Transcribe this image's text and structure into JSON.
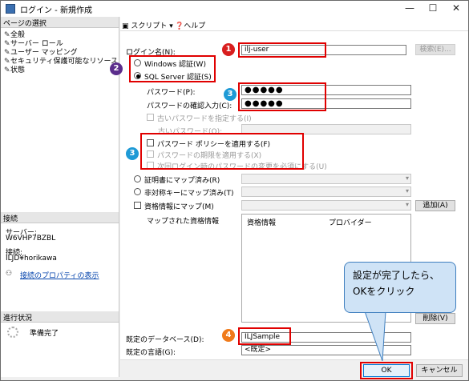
{
  "window": {
    "title": "ログイン - 新規作成"
  },
  "sidebar": {
    "pages_header": "ページの選択",
    "pages": [
      "全般",
      "サーバー ロール",
      "ユーザー マッピング",
      "セキュリティ保護可能なリソース",
      "状態"
    ],
    "connection_header": "接続",
    "server_label": "サーバー:",
    "server_value": "W6VHP7BZBL",
    "conn_label": "接続:",
    "conn_value": "ILJD¥horikawa",
    "conn_props_link": "接続のプロパティの表示",
    "progress_header": "進行状況",
    "progress_status": "準備完了"
  },
  "toolbar": {
    "script": "スクリプト",
    "help": "ヘルプ"
  },
  "form": {
    "login_name_label": "ログイン名(N):",
    "login_name_value": "ilj-user",
    "search_button": "検索(E)...",
    "windows_auth": "Windows 認証(W)",
    "sql_auth": "SQL Server 認証(S)",
    "password_label": "パスワード(P):",
    "password_value": "●●●●●",
    "confirm_label": "パスワードの確認入力(C):",
    "confirm_value": "●●●●●",
    "old_password_label": "古いパスワードを指定する(I)",
    "old_password_field": "古いパスワード(O):",
    "enforce_policy": "パスワード ポリシーを適用する(F)",
    "enforce_expiration": "パスワードの期限を適用する(X)",
    "must_change": "次回ログイン時のパスワードの変更を必須にする(U)",
    "cert_mapped": "証明書にマップ済み(R)",
    "asym_mapped": "非対称キーにマップ済み(T)",
    "cred_mapped": "資格情報にマップ(M)",
    "add_button": "追加(A)",
    "mapped_creds_label": "マップされた資格情報",
    "cred_col": "資格情報",
    "provider_col": "プロバイダー",
    "remove_button": "削除(V)",
    "default_db_label": "既定のデータベース(D):",
    "default_db_value": "ILJSample",
    "default_lang_label": "既定の言語(G):",
    "default_lang_value": "<既定>"
  },
  "annotations": {
    "n1": "1",
    "n2": "2",
    "n3a": "3",
    "n3b": "3",
    "n4": "4",
    "callout": "設定が完了したら、OKをクリック"
  },
  "buttons": {
    "ok": "OK",
    "cancel": "キャンセル"
  },
  "colors": {
    "red": "#e00000",
    "badge_red": "#d81e1e",
    "badge_purple": "#5b2d8c",
    "badge_blue": "#1e9ad6",
    "badge_orange": "#f07a1a",
    "callout_bg": "#cfe3f6"
  }
}
